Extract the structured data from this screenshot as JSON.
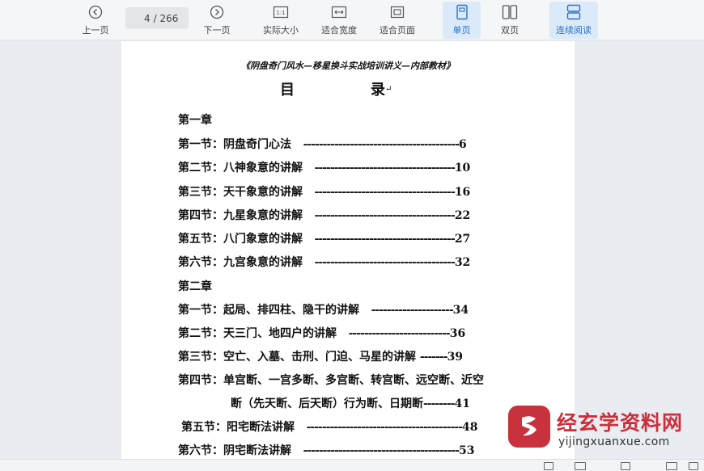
{
  "toolbar": {
    "prev_label": "上一页",
    "page_current": "4",
    "page_total": "/ 266",
    "next_label": "下一页",
    "actual_size_label": "实际大小",
    "fit_width_label": "适合宽度",
    "fit_page_label": "适合页面",
    "single_page_label": "单页",
    "double_page_label": "双页",
    "continuous_label": "连续阅读",
    "accent_color": "#2a72c8"
  },
  "document": {
    "header": "《阴盘奇门风水—移星换斗实战培训讲义—内部教材》",
    "title_char1": "目",
    "title_char2": "录",
    "title_mark": "↵",
    "lines": [
      {
        "label": "第一章",
        "dots": "",
        "page": ""
      },
      {
        "label": "第一节：阴盘奇门心法",
        "dots": "----------------------------------------",
        "page": "6"
      },
      {
        "label": "第二节：八神象意的讲解",
        "dots": "------------------------------------",
        "page": "10"
      },
      {
        "label": "第三节：天干象意的讲解",
        "dots": "------------------------------------",
        "page": "16"
      },
      {
        "label": "第四节：九星象意的讲解",
        "dots": "------------------------------------",
        "page": "22"
      },
      {
        "label": "第五节：八门象意的讲解",
        "dots": "------------------------------------",
        "page": "27"
      },
      {
        "label": "第六节：九宫象意的讲解",
        "dots": "------------------------------------",
        "page": "32"
      },
      {
        "label": "第二章",
        "dots": "",
        "page": ""
      },
      {
        "label": "第一节：起局、排四柱、隐干的讲解",
        "dots": "---------------------",
        "page": "34"
      },
      {
        "label": "第二节：天三门、地四户的讲解",
        "dots": "--------------------------",
        "page": "36"
      },
      {
        "label": "第三节：空亡、入墓、击刑、门迫、马星的讲解",
        "dots": "-------",
        "page": "39"
      },
      {
        "label": "第四节：单宫断、一宫多断、多宫断、转宫断、远空断、近空",
        "dots": "",
        "page": ""
      },
      {
        "label": "断（先天断、后天断）行为断、日期断",
        "dots": "--------",
        "page": "41"
      },
      {
        "label": "第五节：阳宅断法讲解",
        "dots": "----------------------------------------",
        "page": "48"
      },
      {
        "label": "第六节：阴宅断法讲解",
        "dots": "----------------------------------------",
        "page": "53"
      }
    ]
  },
  "watermark": {
    "title": "经玄学资料网",
    "url": "yijingxuanxue.com",
    "color": "#cc2f3a"
  }
}
